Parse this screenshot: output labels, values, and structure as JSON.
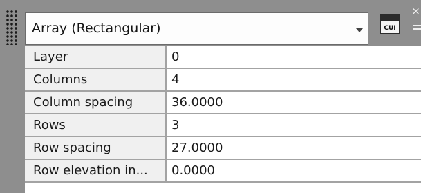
{
  "selector": {
    "value": "Array (Rectangular)",
    "dropdown_icon": "chevron-down-icon",
    "cui_button_label": "CUI"
  },
  "window_controls": {
    "close_glyph": "×",
    "menu_icon": "menu-icon"
  },
  "properties": [
    {
      "label": "Layer",
      "value": "0"
    },
    {
      "label": "Columns",
      "value": "4"
    },
    {
      "label": "Column spacing",
      "value": "36.0000"
    },
    {
      "label": "Rows",
      "value": "3"
    },
    {
      "label": "Row spacing",
      "value": "27.0000"
    },
    {
      "label": "Row elevation in...",
      "value": "0.0000"
    }
  ]
}
